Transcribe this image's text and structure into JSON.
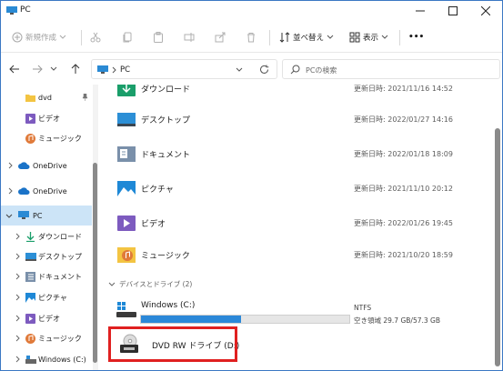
{
  "window": {
    "title": "PC"
  },
  "toolbar": {
    "new_label": "新規作成",
    "sort_label": "並べ替え",
    "view_label": "表示",
    "more_label": "•••"
  },
  "address": {
    "location": "PC"
  },
  "search": {
    "placeholder": "PCの検索"
  },
  "sidebar": {
    "items": [
      {
        "label": "dvd"
      },
      {
        "label": "ビデオ"
      },
      {
        "label": "ミュージック"
      },
      {
        "label": "OneDrive"
      },
      {
        "label": "OneDrive"
      },
      {
        "label": "PC"
      },
      {
        "label": "ダウンロード"
      },
      {
        "label": "デスクトップ"
      },
      {
        "label": "ドキュメント"
      },
      {
        "label": "ピクチャ"
      },
      {
        "label": "ビデオ"
      },
      {
        "label": "ミュージック"
      },
      {
        "label": "Windows (C:)"
      }
    ]
  },
  "folders": [
    {
      "name": "ダウンロード",
      "date": "更新日時: 2021/11/16 14:52"
    },
    {
      "name": "デスクトップ",
      "date": "更新日時: 2022/01/27 14:16"
    },
    {
      "name": "ドキュメント",
      "date": "更新日時: 2022/01/18 18:09"
    },
    {
      "name": "ピクチャ",
      "date": "更新日時: 2021/11/10 20:12"
    },
    {
      "name": "ビデオ",
      "date": "更新日時: 2022/01/26 19:45"
    },
    {
      "name": "ミュージック",
      "date": "更新日時: 2021/10/20 18:59"
    }
  ],
  "drives_group": {
    "label": "デバイスとドライブ (2)"
  },
  "drives": [
    {
      "name": "Windows (C:)",
      "fs": "NTFS",
      "space": "空き領域 29.7 GB/57.3 GB",
      "used_fraction": 0.48
    },
    {
      "name": "DVD RW ドライブ (D:)"
    }
  ],
  "colors": {
    "accent": "#3b78c4",
    "highlight": "#e02020",
    "selected": "#cce4f7",
    "drive_bar": "#2b88d8"
  }
}
